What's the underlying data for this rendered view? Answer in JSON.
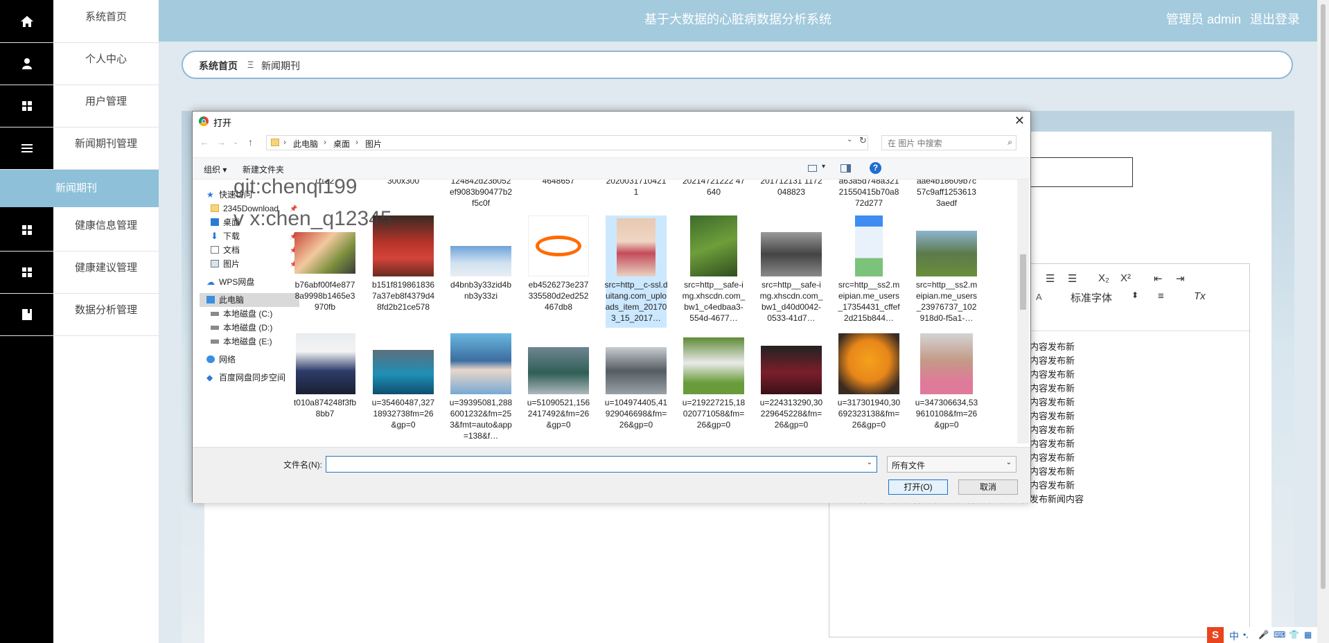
{
  "header": {
    "title": "基于大数据的心脏病数据分析系统",
    "admin_label": "管理员 admin",
    "logout": "退出登录"
  },
  "sidebar": {
    "items": [
      {
        "label": "系统首页",
        "icon": "home-icon"
      },
      {
        "label": "个人中心",
        "icon": "user-icon"
      },
      {
        "label": "用户管理",
        "icon": "grid-icon"
      },
      {
        "label": "新闻期刊管理",
        "icon": "list-icon"
      },
      {
        "label": "新闻期刊",
        "icon": ""
      },
      {
        "label": "健康信息管理",
        "icon": "grid-icon"
      },
      {
        "label": "健康建议管理",
        "icon": "grid-icon"
      },
      {
        "label": "数据分析管理",
        "icon": "book-icon"
      }
    ]
  },
  "breadcrumb": {
    "home": "系统首页",
    "separator": "Ξ",
    "current": "新闻期刊"
  },
  "editor": {
    "toolbar": {
      "font_family": "标准字体",
      "subscript": "X₂",
      "superscript": "X²",
      "clear": "Tx"
    },
    "text_lines": [
      "布新闻内容发布新闻内容发布新闻内容发布新闻内容发布新",
      "布新闻内容发布新闻内容发布新闻内容发布新闻内容发布新",
      "布新闻内容发布新闻内容发布新闻内容发布新闻内容发布新",
      "布新闻内容发布新闻内容发布新闻内容发布新闻内容发布新",
      "布新闻内容发布新闻内容发布新闻内容发布新闻内容发布新",
      "布新闻内容发布新闻内容发布新闻内容发布新闻内容发布新",
      "布新闻内容发布新闻内容发布新闻内容发布新闻内容发布新",
      "布新闻内容发布新闻内容发布新闻内容发布新闻内容发布新",
      "布新闻内容发布新闻内容发布新闻内容发布新闻内容发布新",
      "布新闻内容发布新闻内容发布新闻内容发布新闻内容发布新",
      "布新闻内容发布新闻内容发布新闻内容发布新闻内容发布新",
      "闻内容发布新闻内容发布新闻内容发布新闻内容发布新闻内容"
    ]
  },
  "dialog": {
    "title": "打开",
    "close": "✕",
    "path": [
      "此电脑",
      "桌面",
      "图片"
    ],
    "search_placeholder": "在 图片 中搜索",
    "organize": "组织 ▾",
    "new_folder": "新建文件夹",
    "help": "?",
    "nav": {
      "quick_access": "快速访问",
      "quick_items": [
        "2345Download",
        "桌面",
        "下载",
        "文档",
        "图片"
      ],
      "wps": "WPS网盘",
      "this_pc": "此电脑",
      "drives": [
        "本地磁盘 (C:)",
        "本地磁盘 (D:)",
        "本地磁盘 (E:)"
      ],
      "network": "网络",
      "baidu": "百度网盘同步空间"
    },
    "partial_row": [
      "0122",
      "300x300",
      "124842d23b052ef9083b90477b2f5c0f",
      "4648657",
      "20200317104211",
      "20214721222 47640",
      "201712131 1172048823",
      "a63a5d748a32121550415b70a872d277",
      "aae4b18609b7c57c9aff12536133aedf"
    ],
    "row1": [
      "b76abf00f4e8778a9998b1465e3970fb",
      "b151f8198618367a37eb8f4379d48fd2b21ce578",
      "d4bnb3y33zid4bnb3y33zi",
      "eb4526273e237335580d2ed252467db8",
      "src=http__c-ssl.duitang.com_uploads_item_201703_15_2017…",
      "src=http__safe-img.xhscdn.com_bw1_c4edbaa3-554d-4677…",
      "src=http__safe-img.xhscdn.com_bw1_d40d0042-0533-41d7…",
      "src=http__ss2.meipian.me_users_17354431_cffef2d215b844…",
      "src=http__ss2.meipian.me_users_23976737_102918d0-f5a1-…"
    ],
    "row2": [
      "t010a874248f3fb8bb7",
      "u=35460487,32718932738fm=26&gp=0",
      "u=39395081,2886001232&fm=253&fmt=auto&app=138&f…",
      "u=51090521,1562417492&fm=26&gp=0",
      "u=104974405,41929046698&fm=26&gp=0",
      "u=219227215,18020771058&fm=26&gp=0",
      "u=224313290,30229645228&fm=26&gp=0",
      "u=317301940,30692323138&fm=26&gp=0",
      "u=347306634,539610108&fm=26&gp=0"
    ],
    "filename_label": "文件名(N):",
    "filename_value": "",
    "filetype": "所有文件",
    "open": "打开(O)",
    "cancel": "取消"
  },
  "watermark": {
    "line1": "git:chenqi199",
    "line2": "v x:chen_q12345"
  }
}
